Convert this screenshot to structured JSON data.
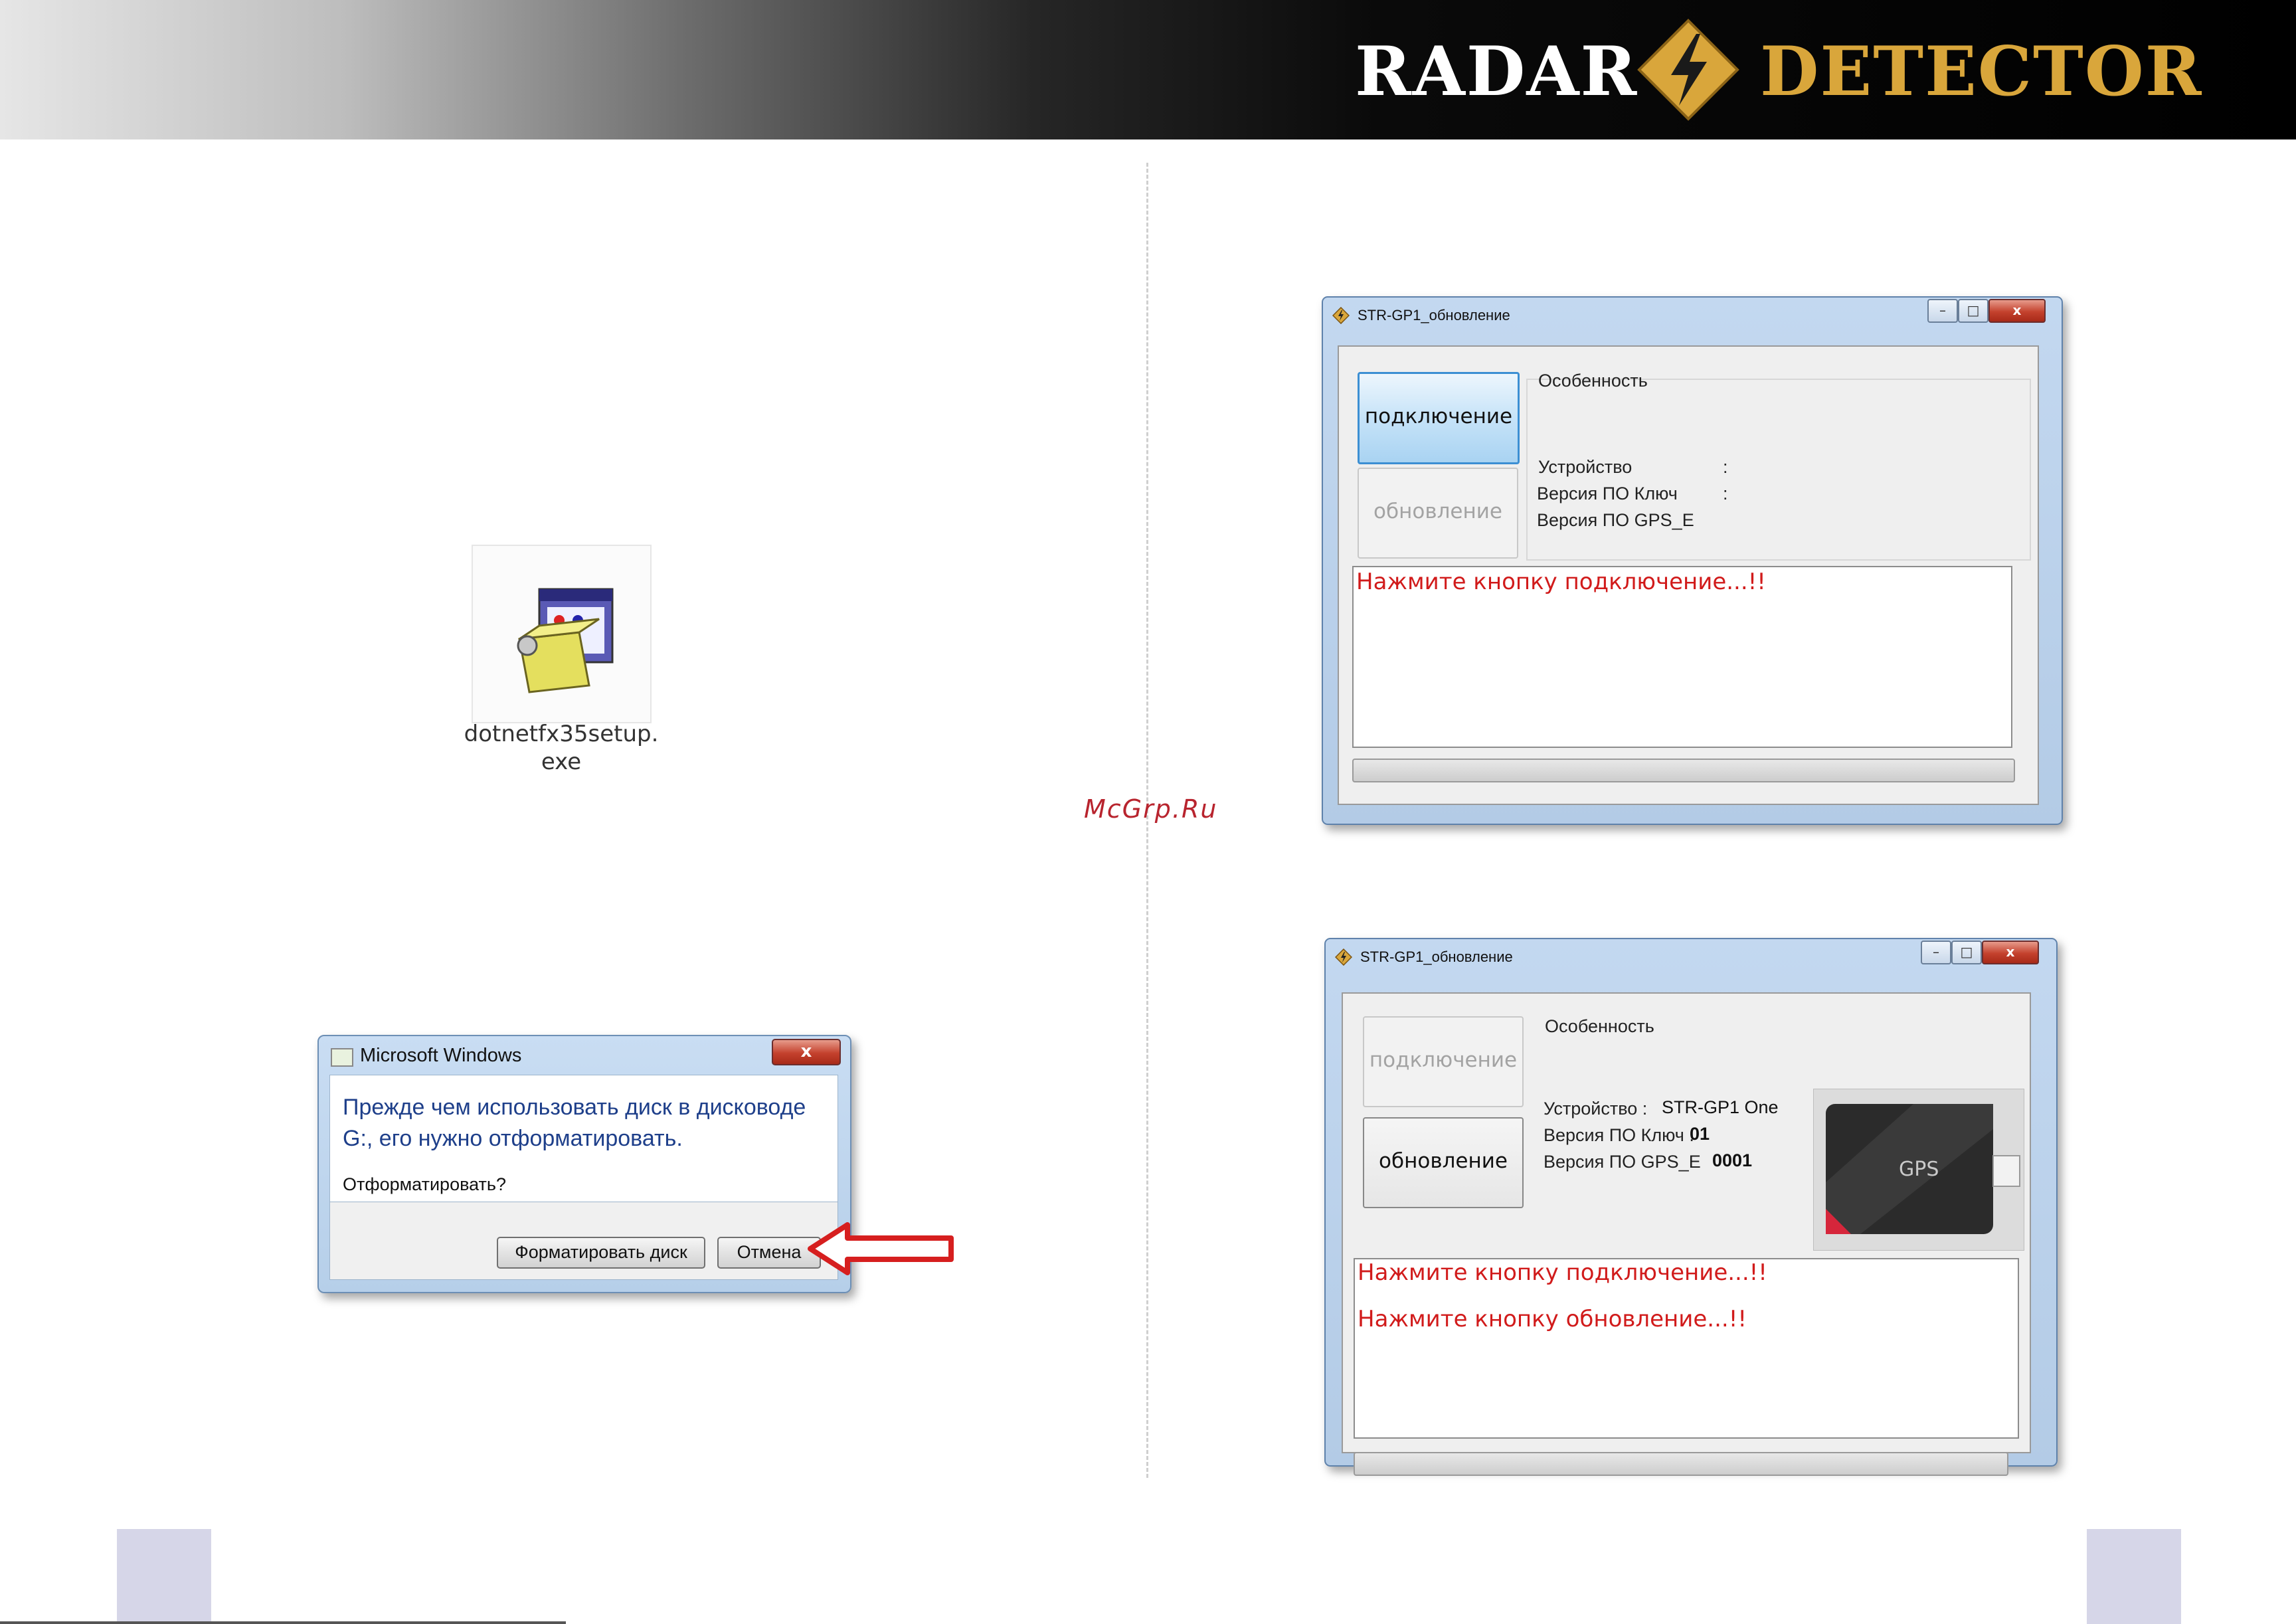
{
  "header": {
    "brand_left": "RADAR",
    "brand_right": "DETECTOR",
    "brand_left_color": "#ffffff",
    "brand_right_color": "#d9a63b",
    "logo_icon": "lightning-diamond-icon"
  },
  "watermark": "McGrp.Ru",
  "file_icon": {
    "icon": "installer-package-icon",
    "name_line1": "dotnetfx35setup.",
    "name_line2": "exe"
  },
  "ms_dialog": {
    "title": "Microsoft Windows",
    "close_label": "x",
    "message_line1": "Прежде чем использовать диск в дисководе",
    "message_line2": "G:, его нужно отформатировать.",
    "question": "Отформатировать?",
    "format_button": "Форматировать диск",
    "cancel_button": "Отмена",
    "arrow_color": "#d61f1f"
  },
  "app_window_1": {
    "title": "STR-GP1_обновление",
    "connect_button": "подключение",
    "update_button": "обновление",
    "features_label": "Особенность",
    "device_label": "Устройство",
    "key_version_label": "Версия ПО Ключ",
    "gps_version_label": "Версия ПО GPS_E",
    "separator": ":",
    "log": [
      "Нажмите кнопку подключение...!!"
    ]
  },
  "app_window_2": {
    "title": "STR-GP1_обновление",
    "connect_button": "подключение",
    "update_button": "обновление",
    "features_label": "Особенность",
    "device_label": "Устройство :",
    "device_value": "STR-GP1 One",
    "key_version_label": "Версия ПО Ключ :",
    "key_version_value": "01",
    "gps_version_label": "Версия ПО GPS_E",
    "gps_version_value": "0001",
    "device_image_label": "GPS",
    "log": [
      "Нажмите кнопку подключение...!!",
      "Нажмите кнопку обновление...!!"
    ]
  }
}
